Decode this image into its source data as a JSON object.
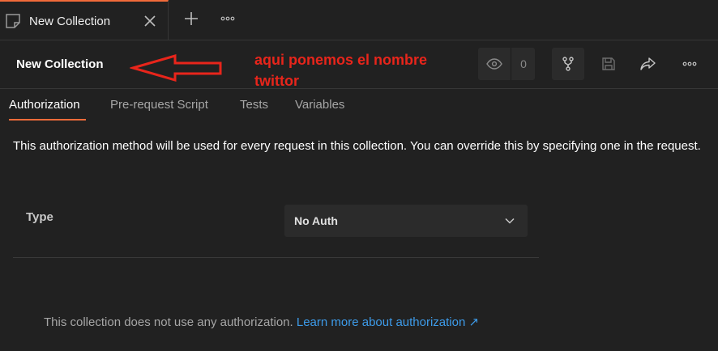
{
  "tabbar": {
    "tab_label": "New Collection",
    "icons": {
      "doc": "collection-doc-icon",
      "close": "close-icon",
      "add": "plus-icon",
      "more": "more-horizontal-icon"
    }
  },
  "header": {
    "title": "New Collection",
    "watch_count": "0",
    "icons": [
      "eye-icon",
      "fork-icon",
      "save-icon",
      "share-icon",
      "more-horizontal-icon"
    ]
  },
  "annotation": {
    "line1": "aqui ponemos el nombre",
    "line2": "twittor",
    "color": "#e8251b"
  },
  "subtabs": [
    {
      "label": "Authorization",
      "active": true
    },
    {
      "label": "Pre-request Script",
      "active": false
    },
    {
      "label": "Tests",
      "active": false
    },
    {
      "label": "Variables",
      "active": false
    }
  ],
  "auth": {
    "description": "This authorization method will be used for every request in this collection. You can override this by specifying one in the request.",
    "type_label": "Type",
    "type_value": "No Auth",
    "footer_text": "This collection does not use any authorization.",
    "footer_link": "Learn more about authorization ↗"
  },
  "colors": {
    "accent": "#f26b3a",
    "link": "#3d9be9",
    "background": "#212121"
  }
}
